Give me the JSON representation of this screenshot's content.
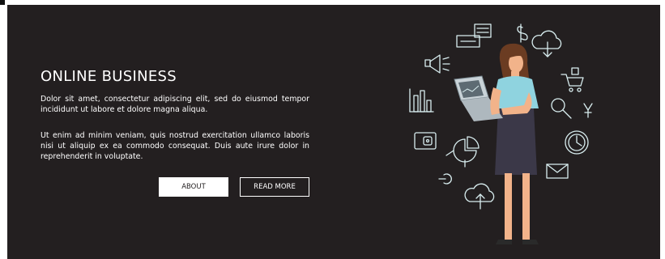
{
  "banner": {
    "title": "ONLINE BUSINESS",
    "paragraph1": "Dolor sit amet, consectetur adipiscing elit, sed do eiusmod tempor incididunt ut labore et dolore magna aliqua.",
    "paragraph2": "Ut enim ad minim veniam, quis nostrud exercitation ullamco laboris nisi ut aliquip ex ea commodo consequat. Duis aute irure dolor in reprehenderit in voluptate.",
    "about_label": "ABOUT",
    "read_more_label": "READ MORE"
  },
  "colors": {
    "background": "#231f20",
    "text": "#ffffff",
    "icon_stroke": "#d9eef0",
    "shirt": "#8fd3df",
    "skirt": "#3b3848",
    "hair": "#6b3c22",
    "skin": "#f2b38a"
  },
  "icons": [
    "cash-register-icon",
    "dollar-icon",
    "cloud-download-icon",
    "megaphone-icon",
    "shopping-cart-icon",
    "bar-chart-icon",
    "magnifier-icon",
    "yen-icon",
    "wallet-icon",
    "clock-icon",
    "pie-chart-icon",
    "euro-icon",
    "envelope-icon",
    "cloud-upload-icon"
  ]
}
